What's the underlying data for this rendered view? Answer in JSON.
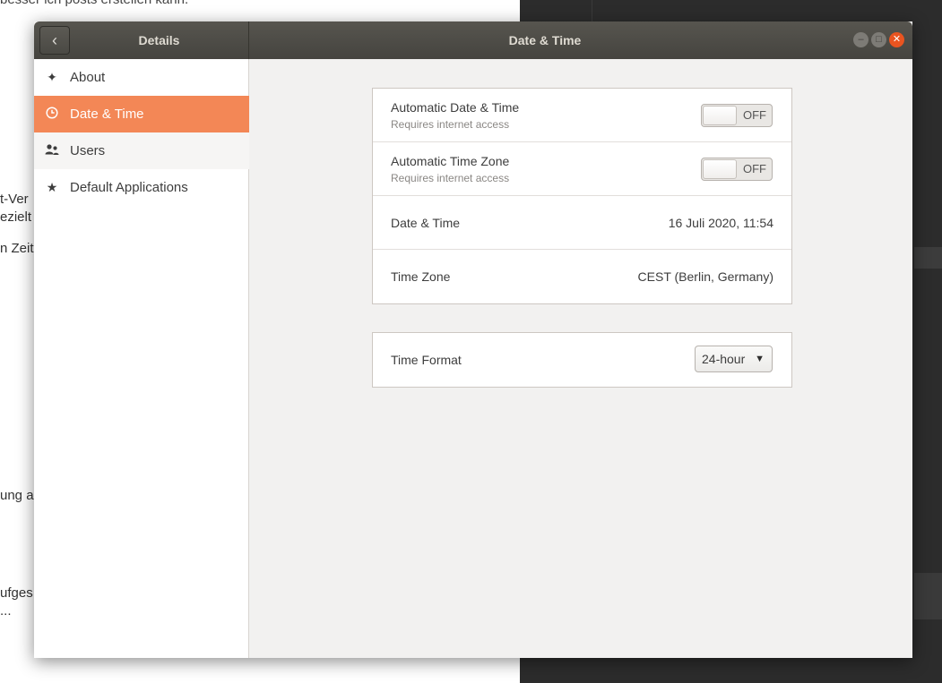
{
  "background": {
    "doc_snippets": [
      "t-Ver",
      "ezielt",
      "n Zeit",
      "ung a",
      "ufges",
      "..."
    ],
    "doc_top_line": "besser ich posts erstellen kann."
  },
  "window": {
    "sidebar_title": "Details",
    "title": "Date & Time"
  },
  "sidebar": {
    "items": [
      {
        "label": "About",
        "icon": "sparkle-icon"
      },
      {
        "label": "Date & Time",
        "icon": "clock-icon"
      },
      {
        "label": "Users",
        "icon": "users-icon"
      },
      {
        "label": "Default Applications",
        "icon": "star-icon"
      }
    ]
  },
  "settings": {
    "auto_datetime": {
      "label": "Automatic Date & Time",
      "sub": "Requires internet access",
      "state": "OFF"
    },
    "auto_timezone": {
      "label": "Automatic Time Zone",
      "sub": "Requires internet access",
      "state": "OFF"
    },
    "datetime": {
      "label": "Date & Time",
      "value": "16 Juli 2020, 11:54"
    },
    "timezone": {
      "label": "Time Zone",
      "value": "CEST (Berlin, Germany)"
    },
    "time_format": {
      "label": "Time Format",
      "value": "24-hour"
    }
  },
  "colors": {
    "accent": "#f38756",
    "close": "#e95420",
    "titlebar": "#4f4d48"
  }
}
